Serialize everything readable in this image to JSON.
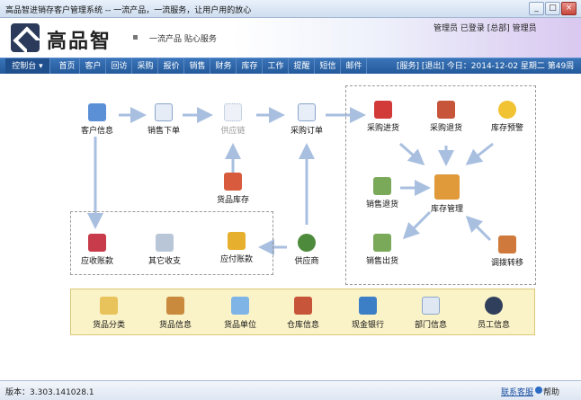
{
  "window": {
    "title": "高品智进销存客户管理系统 -- 一流产品，一流服务，让用户用的放心"
  },
  "header": {
    "logo_text": "高品智",
    "slogan": "一流产品  贴心服务",
    "user_links": "管理员  已登录  [总部]  管理员"
  },
  "nav": {
    "items": [
      "控制台 ▾",
      "首页",
      "客户",
      "回访",
      "采购",
      "报价",
      "销售",
      "财务",
      "库存",
      "工作",
      "提醒",
      "短信",
      "邮件"
    ],
    "right": "[服务]  [退出]  今日：2014-12-02 星期二 第49周"
  },
  "flow": {
    "customer_info": "客户信息",
    "sales_order": "销售下单",
    "supply_chain": "供应链",
    "purchase_order": "采购订单",
    "goods_stock": "货品库存",
    "receivable": "应收账款",
    "other_income": "其它收支",
    "payable": "应付账款",
    "supplier": "供应商",
    "purchase_in": "采购进货",
    "purchase_return": "采购退货",
    "stock_alert": "库存预警",
    "sales_return": "销售退货",
    "stock_mgmt": "库存管理",
    "sales_out": "销售出货",
    "transfer": "调拨转移"
  },
  "bottom": [
    "货品分类",
    "货品信息",
    "货品单位",
    "仓库信息",
    "现金银行",
    "部门信息",
    "员工信息"
  ],
  "status": {
    "version": "版本：3.303.141028.1",
    "service": "联系客服",
    "help": "帮助"
  },
  "colors": {
    "nav": "#2d66aa",
    "bottom_panel": "#fbf3c8",
    "arrow": "#a9bfe0"
  },
  "icons": {
    "customer_info": "people-icon",
    "sales_order": "document-icon",
    "supply_chain": "network-icon",
    "purchase_order": "purchase-doc-icon",
    "goods_stock": "house-icon",
    "receivable": "cards-icon",
    "other_income": "calculator-icon",
    "payable": "wallet-icon",
    "supplier": "person-icon",
    "purchase_in": "cart-icon",
    "purchase_return": "house-return-icon",
    "stock_alert": "bulb-icon",
    "sales_return": "clipboard-return-icon",
    "stock_mgmt": "box-icon",
    "sales_out": "clipboard-out-icon",
    "transfer": "transfer-icon"
  }
}
